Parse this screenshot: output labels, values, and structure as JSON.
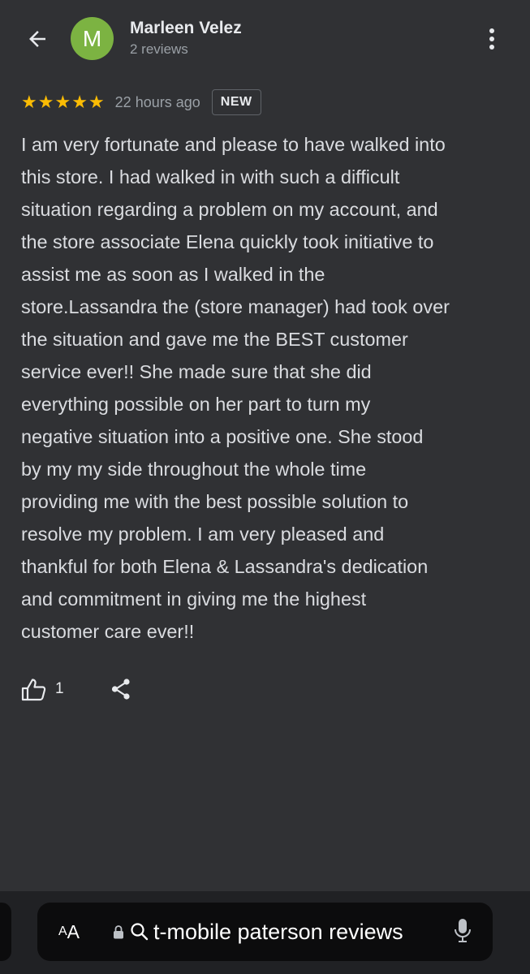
{
  "header": {
    "avatar_letter": "M",
    "user_name": "Marleen Velez",
    "user_reviews": "2 reviews",
    "icons": {
      "back": "arrow-left-icon",
      "more": "more-vert-icon"
    }
  },
  "review": {
    "rating": 5,
    "stars": [
      "★",
      "★",
      "★",
      "★",
      "★"
    ],
    "time": "22 hours ago",
    "badge": "NEW",
    "text": "I am very fortunate and please to have walked into\nthis store. I had walked in with such a difficult\nsituation regarding a problem on my account, and\nthe store associate Elena quickly took initiative to\nassist me as soon as I walked in the\nstore.Lassandra the (store manager) had took over\nthe situation and gave me the BEST customer\nservice ever!! She made sure that she did\neverything possible on her part to turn my\nnegative situation into a positive one. She stood\nby my my side throughout the whole time\nproviding me with the best possible solution to\nresolve my problem. I am very pleased and\nthankful for both Elena & Lassandra's dedication\nand commitment in giving me the highest\ncustomer care ever!!"
  },
  "actions": {
    "like_count": "1",
    "icons": {
      "like": "thumbs-up-icon",
      "share": "share-icon"
    }
  },
  "browser": {
    "reader_small": "A",
    "reader_big": "A",
    "url": "t-mobile paterson reviews",
    "icons": {
      "lock": "lock-icon",
      "search": "search-icon",
      "mic": "microphone-icon"
    }
  },
  "colors": {
    "background": "#303134",
    "avatar": "#7cb342",
    "star": "#fbbc04",
    "secondary_text": "#9aa0a6",
    "address_bar": "#0c0c0d"
  }
}
